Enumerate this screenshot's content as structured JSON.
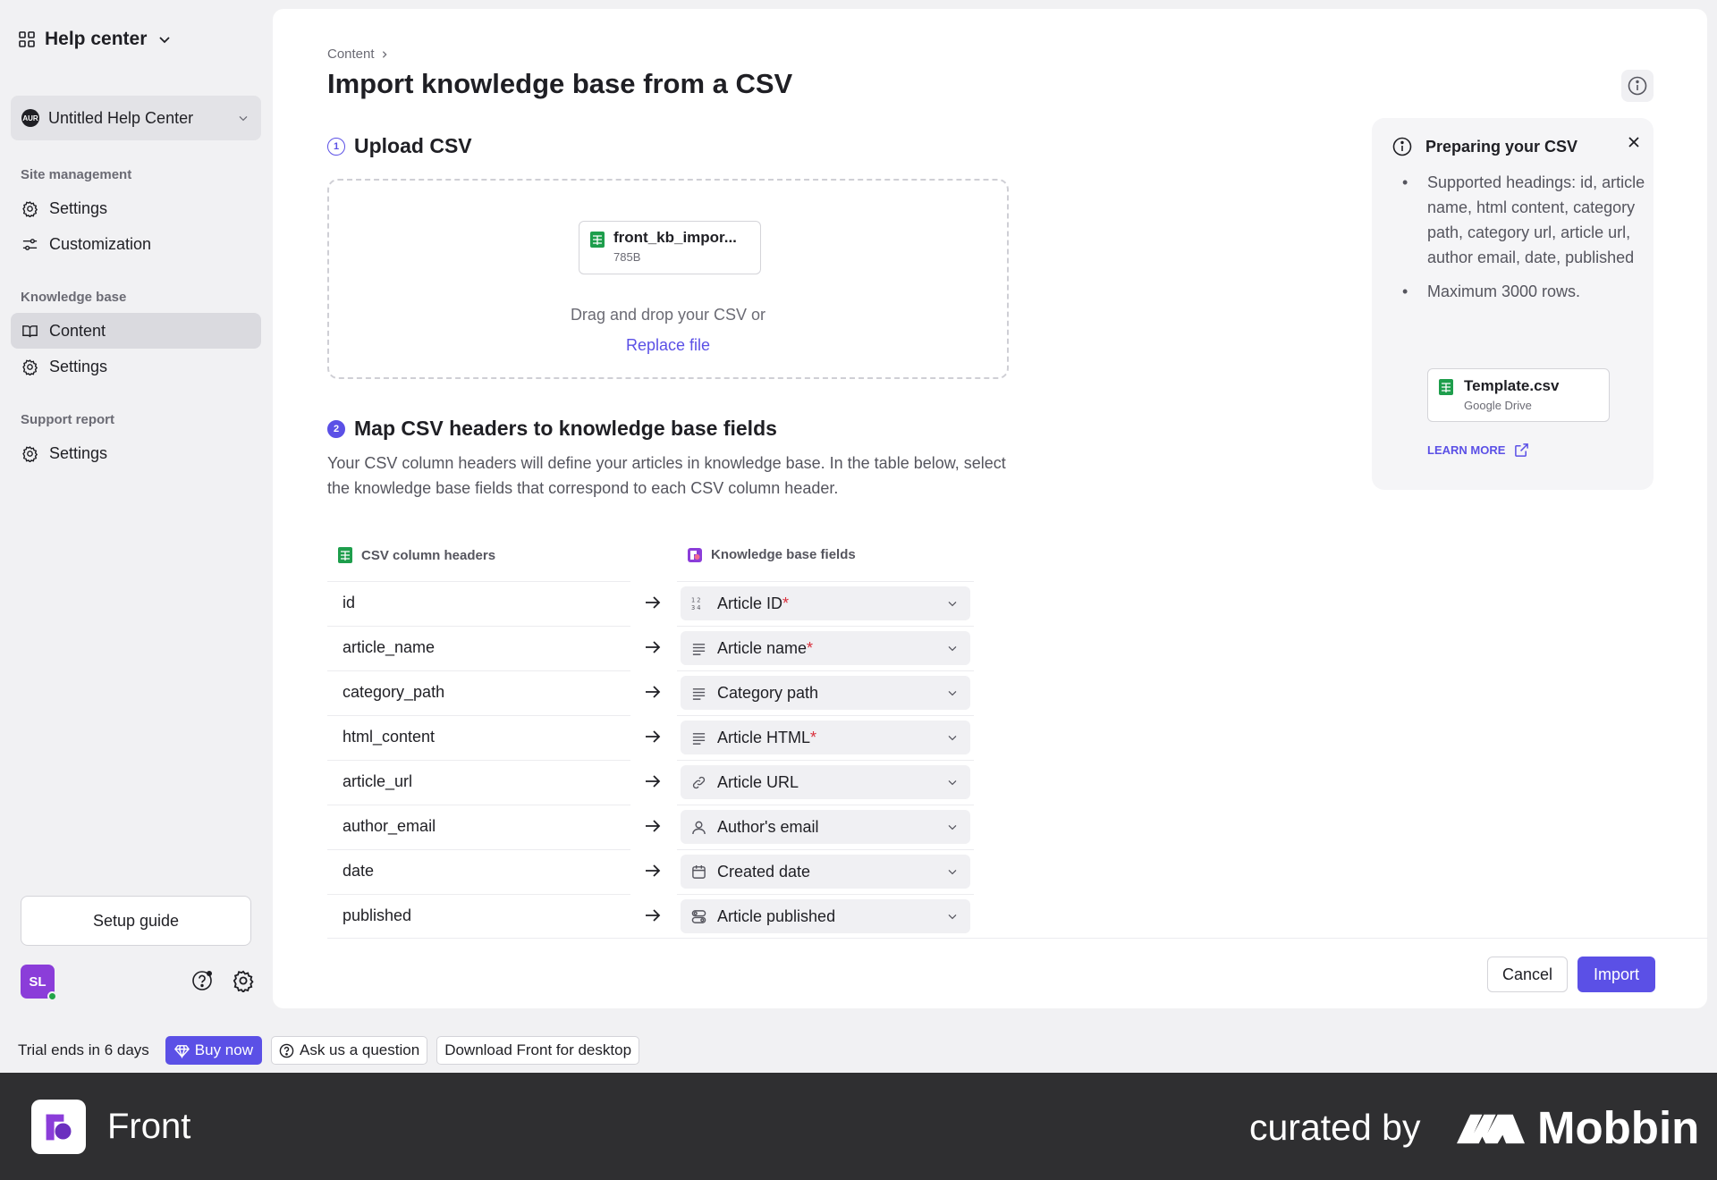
{
  "sidebar": {
    "title": "Help center",
    "workspace": {
      "logo": "AUR",
      "name": "Untitled Help Center"
    },
    "sections": {
      "site_management": "Site management",
      "knowledge_base": "Knowledge base",
      "support_report": "Support report"
    },
    "items": {
      "site_settings": "Settings",
      "customization": "Customization",
      "content": "Content",
      "kb_settings": "Settings",
      "report_settings": "Settings"
    },
    "setup_guide": "Setup guide",
    "avatar_initials": "SL"
  },
  "main": {
    "breadcrumb": "Content",
    "title": "Import knowledge base from a CSV",
    "step1": {
      "number": "1",
      "title": "Upload CSV"
    },
    "file": {
      "name": "front_kb_impor...",
      "size": "785B"
    },
    "drop_text": "Drag and drop your CSV or",
    "replace_link": "Replace file",
    "step2": {
      "number": "2",
      "title": "Map CSV headers to knowledge base fields"
    },
    "map_description": "Your CSV column headers will define your articles in knowledge base. In the table below, select the knowledge base fields that correspond to each CSV column header.",
    "table": {
      "col_csv": "CSV column headers",
      "col_kb": "Knowledge base fields",
      "rows": [
        {
          "csv": "id",
          "kb": "Article ID",
          "required": "*",
          "icon": "number-icon"
        },
        {
          "csv": "article_name",
          "kb": "Article name",
          "required": "*",
          "icon": "text-lines-icon"
        },
        {
          "csv": "category_path",
          "kb": "Category path",
          "required": "",
          "icon": "text-lines-icon"
        },
        {
          "csv": "html_content",
          "kb": "Article HTML",
          "required": "*",
          "icon": "text-lines-icon"
        },
        {
          "csv": "article_url",
          "kb": "Article URL",
          "required": "",
          "icon": "link-icon"
        },
        {
          "csv": "author_email",
          "kb": "Author's email",
          "required": "",
          "icon": "person-icon"
        },
        {
          "csv": "date",
          "kb": "Created date",
          "required": "",
          "icon": "calendar-icon"
        },
        {
          "csv": "published",
          "kb": "Article published",
          "required": "",
          "icon": "toggle-icon"
        }
      ]
    },
    "cancel": "Cancel",
    "import": "Import"
  },
  "prep_panel": {
    "title": "Preparing your CSV",
    "bullets": [
      "Supported headings: id, article name, html content, category path, category url, article url, author email, date, published",
      "Maximum 3000 rows."
    ],
    "template": {
      "name": "Template.csv",
      "source": "Google Drive"
    },
    "learn_more": "LEARN MORE"
  },
  "trial_bar": {
    "text": "Trial ends in 6 days",
    "buy_now": "Buy now",
    "ask": "Ask us a question",
    "download": "Download Front for desktop"
  },
  "branding": {
    "app_name": "Front",
    "curated_by": "curated by",
    "mobbin": "Mobbin"
  },
  "colors": {
    "accent": "#5b50e6",
    "required": "#d9303c",
    "sheet_green": "#1e9e4c",
    "avatar": "#8b3dd9"
  }
}
